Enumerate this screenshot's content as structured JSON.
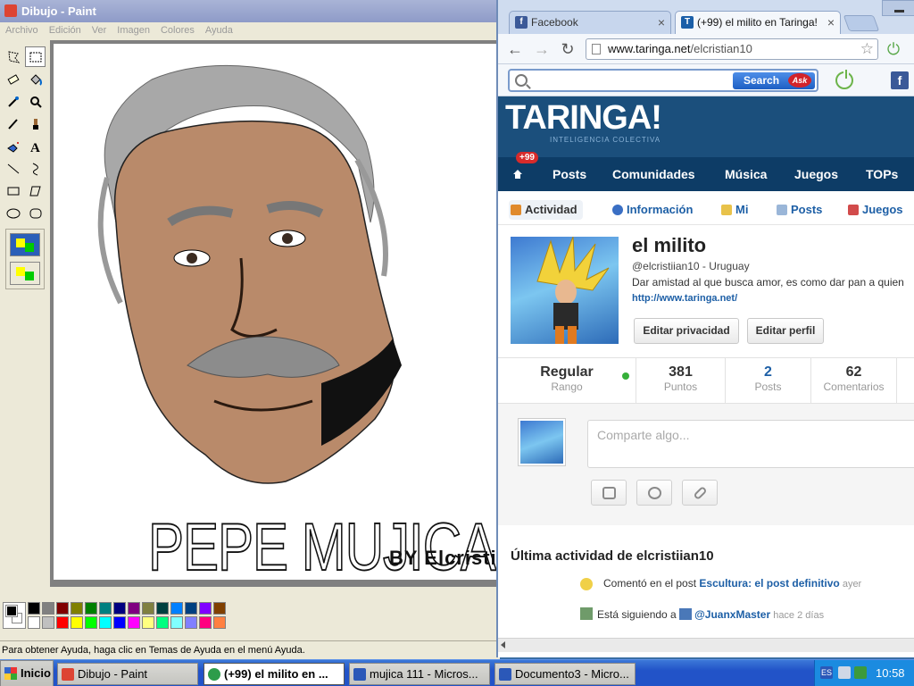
{
  "paint": {
    "title": "Dibujo - Paint",
    "menu": [
      "Archivo",
      "Edición",
      "Ver",
      "Imagen",
      "Colores",
      "Ayuda"
    ],
    "tools": [
      "free-select",
      "rect-select",
      "eraser",
      "fill",
      "color-picker",
      "magnifier",
      "pencil",
      "brush",
      "airbrush",
      "text",
      "line",
      "curve",
      "rectangle",
      "polygon",
      "ellipse",
      "rounded-rectangle"
    ],
    "canvas": {
      "poster_title": "PEPE MUJICA",
      "poster_by": "BY  Elcristiian"
    },
    "palette": [
      "#000000",
      "#808080",
      "#800000",
      "#808000",
      "#008000",
      "#008080",
      "#000080",
      "#800080",
      "#808040",
      "#004040",
      "#0080ff",
      "#004080",
      "#8000ff",
      "#804000",
      "#ffffff",
      "#c0c0c0",
      "#ff0000",
      "#ffff00",
      "#00ff00",
      "#00ffff",
      "#0000ff",
      "#ff00ff",
      "#ffff80",
      "#00ff80",
      "#80ffff",
      "#8080ff",
      "#ff0080",
      "#ff8040"
    ],
    "status": "Para obtener Ayuda, haga clic en Temas de Ayuda en el menú Ayuda."
  },
  "browser": {
    "tabs": [
      {
        "label": "Facebook",
        "icon": "facebook-icon",
        "color": "#3b5998",
        "glyph": "f"
      },
      {
        "label": "(+99) el milito en Taringa!",
        "icon": "taringa-icon",
        "color": "#1b5fa8",
        "glyph": "T"
      }
    ],
    "url_host": "www.taringa.net",
    "url_path": "/elcristian10",
    "ask": {
      "search_label": "Search",
      "logo": "Ask"
    },
    "site": {
      "logo": "TARINGA!",
      "tagline": "INTELIGENCIA COLECTIVA",
      "badge": "+99",
      "nav": [
        "Posts",
        "Comunidades",
        "Música",
        "Juegos",
        "TOPs"
      ],
      "subnav": [
        "Actividad",
        "Información",
        "Mi",
        "Posts",
        "Juegos"
      ],
      "profile": {
        "name": "el milito",
        "handle": "@elcristiian10 - Uruguay",
        "bio": "Dar amistad al que busca amor, es como dar pan a quien",
        "link": "http://www.taringa.net/",
        "edit_privacy": "Editar privacidad",
        "edit_profile": "Editar perfil"
      },
      "stats": [
        {
          "value": "Regular",
          "label": "Rango"
        },
        {
          "value": "381",
          "label": "Puntos"
        },
        {
          "value": "2",
          "label": "Posts"
        },
        {
          "value": "62",
          "label": "Comentarios"
        }
      ],
      "share_placeholder": "Comparte algo...",
      "activity_title": "Última actividad de elcristiian10",
      "activity": [
        {
          "text": "Comentó en el post ",
          "link": "Escultura: el post definitivo",
          "time": " ayer"
        },
        {
          "text": "Está siguiendo a ",
          "link": "@JuanxMaster",
          "time": " hace 2 días"
        }
      ]
    }
  },
  "taskbar": {
    "start": "Inicio",
    "tasks": [
      {
        "label": "Dibujo - Paint",
        "color": "#d43"
      },
      {
        "label": "(+99) el milito en ...",
        "color": "#2d9c4a"
      },
      {
        "label": "mujica 111 - Micros...",
        "color": "#2b58b8"
      },
      {
        "label": "Documento3 - Micro...",
        "color": "#2b58b8"
      }
    ],
    "lang": "ES",
    "clock": "10:58"
  }
}
